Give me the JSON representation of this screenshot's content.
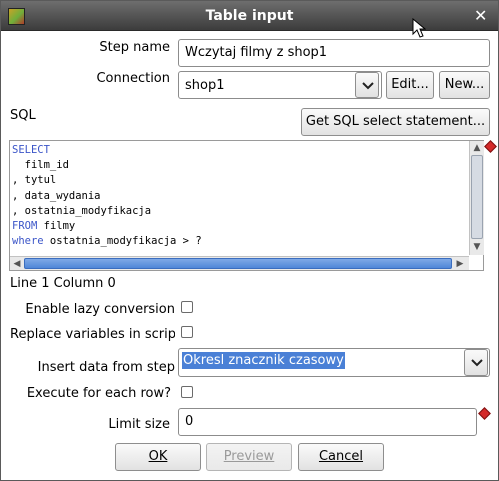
{
  "window": {
    "title": "Table input"
  },
  "form": {
    "step_name_label": "Step name",
    "step_name_value": "Wczytaj filmy z shop1",
    "connection_label": "Connection",
    "connection_value": "shop1",
    "edit_label": "Edit...",
    "new_label": "New...",
    "sql_label": "SQL",
    "get_sql_label": "Get SQL select statement...",
    "sql_lines": [
      "SELECT",
      "  film_id",
      ", tytul",
      ", data_wydania",
      ", ostatnia_modyfikacja",
      "FROM filmy",
      "where ostatnia_modyfikacja > ?"
    ],
    "position_status": "Line 1 Column 0",
    "lazy_conversion_label": "Enable lazy conversion",
    "lazy_conversion_checked": false,
    "replace_variables_label": "Replace variables in scrip",
    "replace_variables_checked": false,
    "insert_data_label": "Insert data from step",
    "insert_data_value": "Okresl znacznik czasowy",
    "execute_each_row_label": "Execute for each row?",
    "execute_each_row_checked": false,
    "limit_size_label": "Limit size",
    "limit_size_value": "0"
  },
  "buttons": {
    "ok": "OK",
    "preview": "Preview",
    "cancel": "Cancel"
  },
  "colors": {
    "sql_keyword": "#3b55c8",
    "selection": "#4a80d6",
    "required_marker": "#d42a2a"
  }
}
